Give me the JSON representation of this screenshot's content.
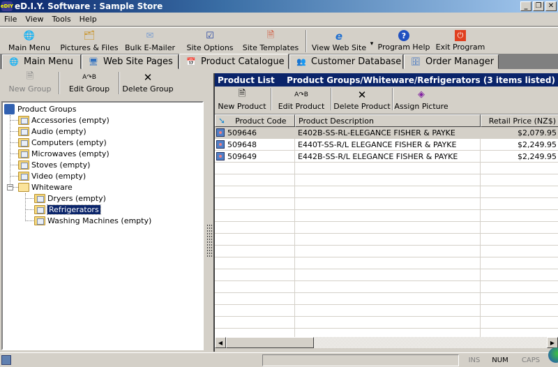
{
  "window": {
    "title": "eD.I.Y. Software :  Sample Store",
    "app_icon_text": "eDIY",
    "minimize": "_",
    "restore": "❐",
    "close": "✕"
  },
  "menu": [
    "File",
    "View",
    "Tools",
    "Help"
  ],
  "toolbar": [
    {
      "label": "Main Menu",
      "icon": "globe-lightning-icon",
      "glyph": "🌐"
    },
    {
      "label": "Pictures & Files",
      "icon": "pictures-files-icon",
      "glyph": "🗂"
    },
    {
      "label": "Bulk E-Mailer",
      "icon": "envelope-icon",
      "glyph": "✉"
    },
    {
      "label": "Site Options",
      "icon": "site-options-icon",
      "glyph": "☑"
    },
    {
      "label": "Site Templates",
      "icon": "site-templates-icon",
      "glyph": "🗎"
    },
    {
      "label": "View Web Site",
      "icon": "internet-explorer-icon",
      "glyph": "e",
      "dropdown": "▾"
    },
    {
      "label": "Program Help",
      "icon": "help-icon",
      "glyph": "?"
    },
    {
      "label": "Exit Program",
      "icon": "exit-icon",
      "glyph": "⏻"
    }
  ],
  "tabs": [
    {
      "label": "Main Menu",
      "glyph": "🌐",
      "icon": "globe-lightning-icon"
    },
    {
      "label": "Web Site Pages",
      "glyph": "🖥",
      "icon": "web-pages-icon"
    },
    {
      "label": "Product Catalogue",
      "glyph": "📅",
      "icon": "catalogue-icon",
      "active": true
    },
    {
      "label": "Customer Database",
      "glyph": "👥",
      "icon": "customers-icon"
    },
    {
      "label": "Order Manager",
      "glyph": "🗄",
      "icon": "order-manager-icon"
    }
  ],
  "group_toolbar": {
    "new_group": "New Group",
    "edit_group": "Edit Group",
    "delete_group": "Delete Group"
  },
  "tree": {
    "root": "Product Groups",
    "items": [
      "Accessories (empty)",
      "Audio (empty)",
      "Computers (empty)",
      "Microwaves (empty)",
      "Stoves (empty)",
      "Video (empty)",
      "Whiteware"
    ],
    "expander": "−",
    "whiteware_children": [
      "Dryers (empty)",
      "Refrigerators",
      "Washing Machines (empty)"
    ],
    "selected": "Refrigerators"
  },
  "product_list": {
    "title": "Product List",
    "path": "Product Groups/Whiteware/Refrigerators (3 items listed)",
    "toolbar": {
      "new_product": "New Product",
      "edit_product": "Edit Product",
      "delete_product": "Delete Product",
      "assign_picture": "Assign Picture"
    },
    "columns": [
      "Product Code",
      "Product Description",
      "Retail Price (NZ$)"
    ],
    "rows": [
      {
        "code": "509646",
        "description": "E402B-SS-RL-ELEGANCE FISHER & PAYKE",
        "price": "$2,079.95"
      },
      {
        "code": "509648",
        "description": "E440T-SS-R/L ELEGANCE FISHER & PAYKE",
        "price": "$2,249.95"
      },
      {
        "code": "509649",
        "description": "E442B-SS-R/L ELEGANCE FISHER & PAYKE",
        "price": "$2,249.95"
      }
    ],
    "selected_row": 0
  },
  "statusbar": {
    "ins": "INS",
    "num": "NUM",
    "caps": "CAPS"
  }
}
